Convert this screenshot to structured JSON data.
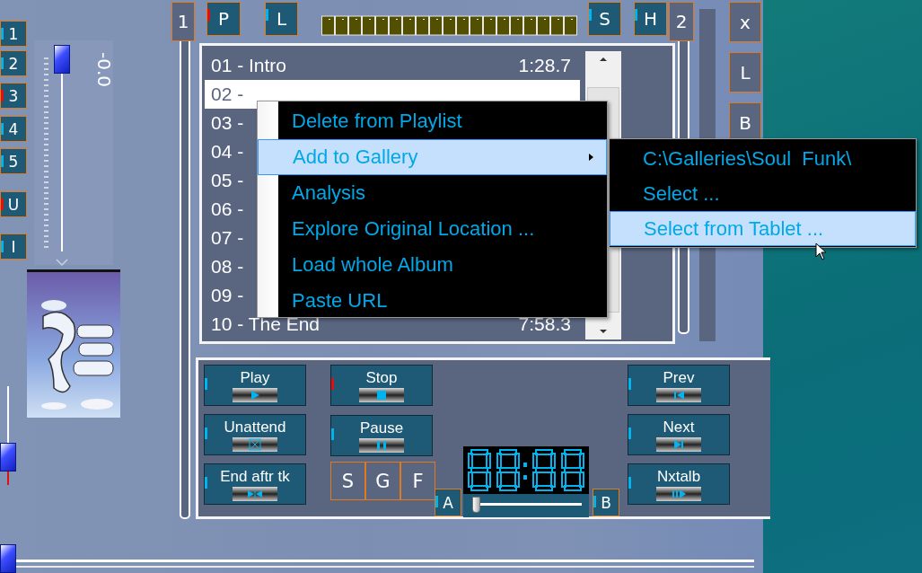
{
  "presets": [
    {
      "label": "1",
      "color": "#00b4f0"
    },
    {
      "label": "2",
      "color": "#00b4f0"
    },
    {
      "label": "3",
      "color": "#e01010"
    },
    {
      "label": "4",
      "color": "#00b4f0"
    },
    {
      "label": "5",
      "color": "#00b4f0"
    },
    {
      "label": "U",
      "color": "#e01010"
    },
    {
      "label": "I",
      "color": "#00b4f0"
    }
  ],
  "volume": {
    "level": 1,
    "reading": "-0.0"
  },
  "balance": {
    "level": 0.3
  },
  "position": {
    "level": 0
  },
  "top_buttons": [
    {
      "label": "1",
      "kind": "deck"
    },
    {
      "label": "P",
      "kind": "toggle",
      "color": "#e01010"
    },
    {
      "label": "L",
      "kind": "toggle",
      "color": "#00b4f0"
    },
    {
      "label": "S",
      "kind": "toggle",
      "color": "#00b4f0"
    },
    {
      "label": "H",
      "kind": "toggle",
      "color": "#00b4f0"
    },
    {
      "label": "2",
      "kind": "deck"
    }
  ],
  "side_buttons": [
    "x",
    "L",
    "B"
  ],
  "playlist": [
    {
      "title": "01 - Intro",
      "duration": "1:28.7",
      "selected": false
    },
    {
      "title": "02 -",
      "selected": true
    },
    {
      "title": "03 -",
      "selected": false
    },
    {
      "title": "04 -",
      "selected": false
    },
    {
      "title": "05 -",
      "selected": false
    },
    {
      "title": "06 -",
      "selected": false
    },
    {
      "title": "07 -",
      "selected": false
    },
    {
      "title": "08 -",
      "selected": false
    },
    {
      "title": "09 -",
      "selected": false
    },
    {
      "title": "10 - The End",
      "duration": "7:58.3",
      "selected": false
    }
  ],
  "transport_left": [
    {
      "label": "Play",
      "kind": "play",
      "color": "#00b4f0"
    },
    {
      "label": "Unattend",
      "kind": "unattend",
      "color": "#00b4f0"
    },
    {
      "label": "End aftr tk",
      "kind": "end",
      "color": "#00b4f0"
    }
  ],
  "transport_mid": [
    {
      "label": "Stop",
      "kind": "stop",
      "color": "#e01010"
    },
    {
      "label": "Pause",
      "kind": "pause",
      "color": "#00b4f0"
    }
  ],
  "transport_right": [
    {
      "label": "Prev",
      "kind": "prev",
      "color": "#00b4f0"
    },
    {
      "label": "Next",
      "kind": "next",
      "color": "#00b4f0"
    },
    {
      "label": "Nxtalb",
      "kind": "nxtalb",
      "color": "#00b4f0"
    }
  ],
  "modes": [
    "S",
    "G",
    "F"
  ],
  "loop_a": {
    "label": "A",
    "color": "#00b4f0"
  },
  "loop_b": {
    "label": "B",
    "color": "#00b4f0"
  },
  "seek": {
    "level": 0
  },
  "context_menu": [
    {
      "label": "Delete from Playlist",
      "selected": false,
      "has_submenu": false
    },
    {
      "label": "Add to Gallery",
      "selected": true,
      "has_submenu": true
    },
    {
      "label": "Analysis",
      "selected": false,
      "has_submenu": false
    },
    {
      "label": "Explore Original Location ...",
      "selected": false,
      "has_submenu": false
    },
    {
      "label": "Load whole Album",
      "selected": false,
      "has_submenu": false
    },
    {
      "label": "Paste URL",
      "selected": false,
      "has_submenu": false
    }
  ],
  "submenu": [
    {
      "label": "C:\\Galleries\\Soul  Funk\\",
      "selected": false
    },
    {
      "label": "Select ...",
      "selected": false
    },
    {
      "label": "Select from Tablet ...",
      "selected": true
    }
  ]
}
